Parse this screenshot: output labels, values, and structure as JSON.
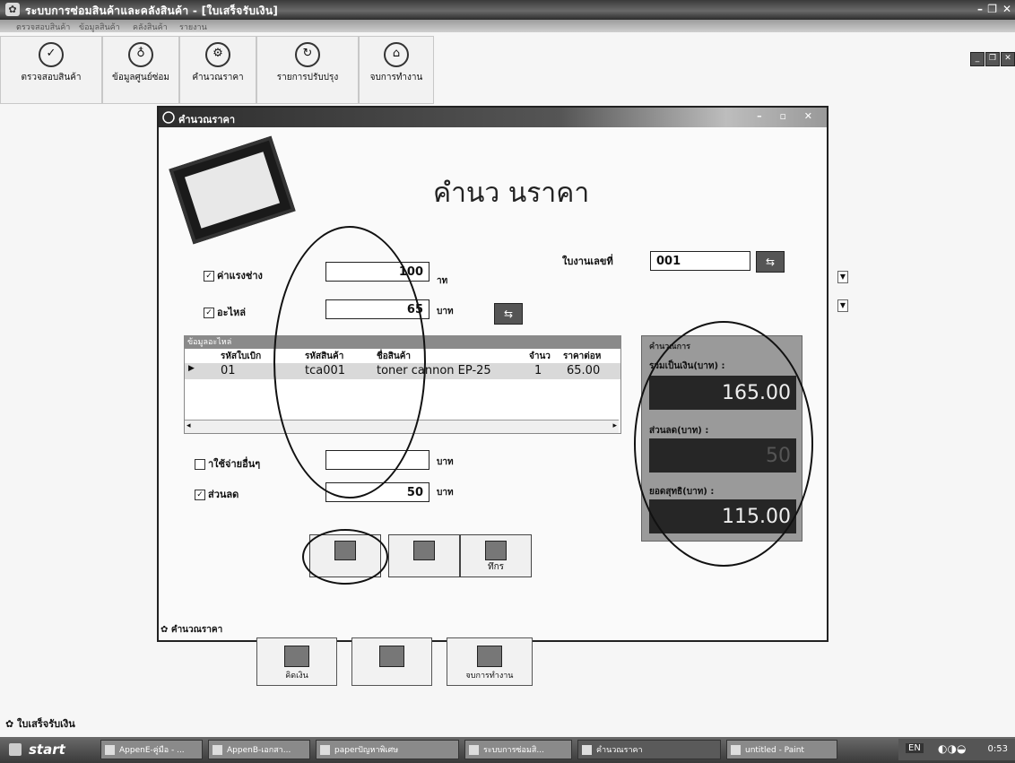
{
  "window": {
    "title": "ระบบการซ่อมสินค้าและคลังสินค้า - [ใบเสร็จรับเงิน]",
    "menu": [
      "ตรวจสอบสินค้า",
      "ข้อมูลสินค้า",
      "คลังสินค้า",
      "รายงาน"
    ]
  },
  "toolbar": {
    "items": [
      {
        "label": "ตรวจสอบสินค้า",
        "icon": "check-icon"
      },
      {
        "label": "ข้อมูลศูนย์ซ่อม",
        "icon": "service-center-icon"
      },
      {
        "label": "คำนวณราคา",
        "icon": "calculator-icon"
      },
      {
        "label": "รายการปรับปรุง",
        "icon": "update-icon"
      },
      {
        "label": "จบการทำงาน",
        "icon": "exit-icon"
      }
    ]
  },
  "dialog": {
    "title": "คำนวณราคา",
    "heading": "คำนว  นราคา",
    "job_no_label": "ใบงานเลขที่",
    "job_no": "001",
    "labor_label": "ค่าแรงช่าง",
    "labor_value": "100",
    "labor_unit": "าท",
    "parts_label": "อะไหล่",
    "parts_value": "65",
    "parts_unit": "บาท",
    "grid": {
      "caption": "ข้อมูลอะไหล่",
      "columns": [
        "รหัสใบเบิก",
        "รหัสสินค้า",
        "ชื่อสินค้า",
        "จำนว",
        "ราคาต่อห"
      ],
      "rows": [
        {
          "req_id": "01",
          "product_id": "tca001",
          "name": "toner cannon EP-25",
          "qty": "1",
          "price": "65.00"
        }
      ]
    },
    "other_label": "าใช้จ่ายอื่นๆ",
    "other_value": "",
    "other_unit": "บาท",
    "discount_label": "ส่วนลด",
    "discount_value": "50",
    "discount_unit": "บาท",
    "result": {
      "caption": "คำนวณการ",
      "total_label": "รวมเป็นเงิน(บาท) :",
      "total": "165.00",
      "discount_label": "ส่วนลด(บาท) :",
      "discount": "50",
      "net_label": "ยอดสุทธิ(บาท) :",
      "net": "115.00"
    },
    "buttons": {
      "calc": "",
      "clear": "",
      "save": "ทึกร"
    },
    "status": "คำนวณราคา"
  },
  "outer_buttons": {
    "calc": "คิดเงิน",
    "clear": "",
    "exit": "จบการทำงาน"
  },
  "footer_label": "ใบเสร็จรับเงิน",
  "taskbar": {
    "start": "start",
    "tasks": [
      "AppenE-คู่มือ - ...",
      "AppenB-เอกสา...",
      "paperปัญหาพิเศษ",
      "ระบบการซ่อมสิ...",
      "คำนวณราคา",
      "untitled - Paint"
    ],
    "lang": "EN",
    "clock": "0:53"
  }
}
